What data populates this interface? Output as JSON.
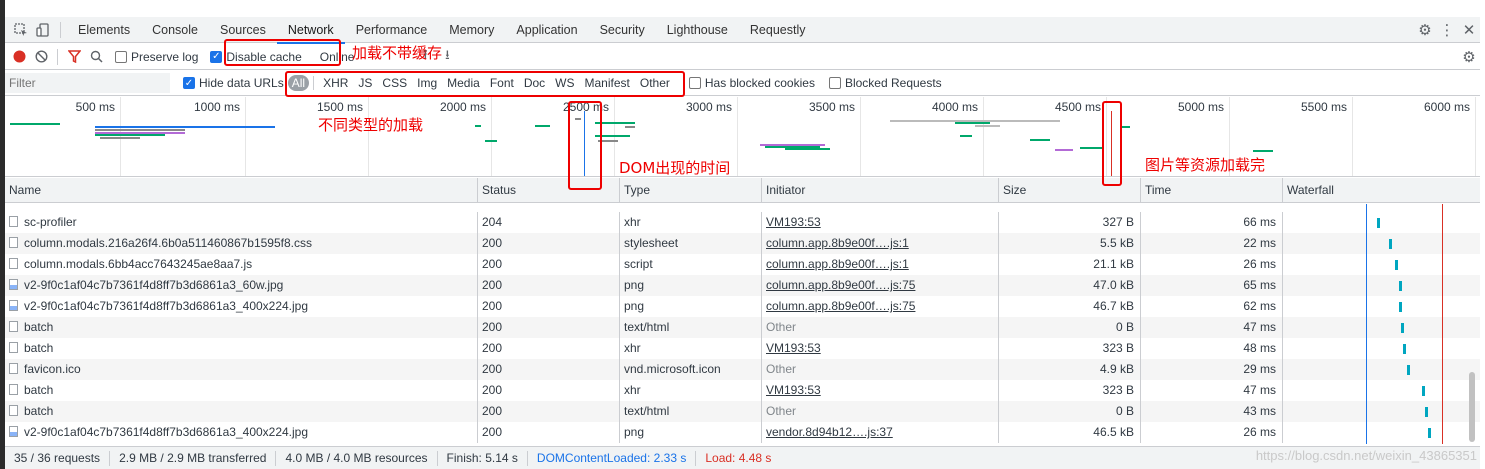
{
  "tabs": [
    "Elements",
    "Console",
    "Sources",
    "Network",
    "Performance",
    "Memory",
    "Application",
    "Security",
    "Lighthouse",
    "Requestly"
  ],
  "toolbar": {
    "preserve_log": "Preserve log",
    "disable_cache": "Disable cache",
    "throttling": "Online"
  },
  "filter": {
    "placeholder": "Filter",
    "hide_data_urls": "Hide data URLs",
    "types": [
      "All",
      "XHR",
      "JS",
      "CSS",
      "Img",
      "Media",
      "Font",
      "Doc",
      "WS",
      "Manifest",
      "Other"
    ],
    "has_blocked_cookies": "Has blocked cookies",
    "blocked_requests": "Blocked Requests"
  },
  "overview": {
    "ticks": [
      "500 ms",
      "1000 ms",
      "1500 ms",
      "2000 ms",
      "2500 ms",
      "3000 ms",
      "3500 ms",
      "4000 ms",
      "4500 ms",
      "5000 ms",
      "5500 ms",
      "6000 ms"
    ]
  },
  "annotations": {
    "disable_cache": "加载不带缓存",
    "types": "不同类型的加载",
    "dom": "DOM出现的时间",
    "load": "图片等资源加载完"
  },
  "columns": [
    "Name",
    "Status",
    "Type",
    "Initiator",
    "Size",
    "Time",
    "Waterfall"
  ],
  "requests": [
    {
      "name": "sc-profiler",
      "status": "204",
      "type": "xhr",
      "initiator": "VM193:53",
      "initiator_link": true,
      "size": "327 B",
      "time": "66 ms",
      "icon": "file",
      "wf": 0.16
    },
    {
      "name": "column.modals.216a26f4.6b0a511460867b1595f8.css",
      "status": "200",
      "type": "stylesheet",
      "initiator": "column.app.8b9e00f….js:1",
      "initiator_link": true,
      "size": "5.5 kB",
      "time": "22 ms",
      "icon": "file",
      "wf": 0.18
    },
    {
      "name": "column.modals.6bb4acc7643245ae8aa7.js",
      "status": "200",
      "type": "script",
      "initiator": "column.app.8b9e00f….js:1",
      "initiator_link": true,
      "size": "21.1 kB",
      "time": "26 ms",
      "icon": "file",
      "wf": 0.19
    },
    {
      "name": "v2-9f0c1af04c7b7361f4d8ff7b3d6861a3_60w.jpg",
      "status": "200",
      "type": "png",
      "initiator": "column.app.8b9e00f….js:75",
      "initiator_link": true,
      "size": "47.0 kB",
      "time": "65 ms",
      "icon": "img",
      "wf": 0.197
    },
    {
      "name": "v2-9f0c1af04c7b7361f4d8ff7b3d6861a3_400x224.jpg",
      "status": "200",
      "type": "png",
      "initiator": "column.app.8b9e00f….js:75",
      "initiator_link": true,
      "size": "46.7 kB",
      "time": "62 ms",
      "icon": "img",
      "wf": 0.197
    },
    {
      "name": "batch",
      "status": "200",
      "type": "text/html",
      "initiator": "Other",
      "initiator_link": false,
      "size": "0 B",
      "time": "47 ms",
      "icon": "file",
      "wf": 0.2
    },
    {
      "name": "batch",
      "status": "200",
      "type": "xhr",
      "initiator": "VM193:53",
      "initiator_link": true,
      "size": "323 B",
      "time": "48 ms",
      "icon": "file",
      "wf": 0.203
    },
    {
      "name": "favicon.ico",
      "status": "200",
      "type": "vnd.microsoft.icon",
      "initiator": "Other",
      "initiator_link": false,
      "size": "4.9 kB",
      "time": "29 ms",
      "icon": "file",
      "wf": 0.21
    },
    {
      "name": "batch",
      "status": "200",
      "type": "xhr",
      "initiator": "VM193:53",
      "initiator_link": true,
      "size": "323 B",
      "time": "47 ms",
      "icon": "file",
      "wf": 0.235
    },
    {
      "name": "batch",
      "status": "200",
      "type": "text/html",
      "initiator": "Other",
      "initiator_link": false,
      "size": "0 B",
      "time": "43 ms",
      "icon": "file",
      "wf": 0.24
    },
    {
      "name": "v2-9f0c1af04c7b7361f4d8ff7b3d6861a3_400x224.jpg",
      "status": "200",
      "type": "png",
      "initiator": "vendor.8d94b12….js:37",
      "initiator_link": true,
      "size": "46.5 kB",
      "time": "26 ms",
      "icon": "img",
      "wf": 0.245
    }
  ],
  "statusbar": {
    "requests": "35 / 36 requests",
    "transferred": "2.9 MB / 2.9 MB transferred",
    "resources": "4.0 MB / 4.0 MB resources",
    "finish": "Finish: 5.14 s",
    "dcl": "DOMContentLoaded: 2.33 s",
    "load": "Load: 4.48 s"
  },
  "colors": {
    "dcl": "#1a73e8",
    "load": "#d93025",
    "annotation": "#e00000"
  },
  "watermark": "https://blog.csdn.net/weixin_43865351"
}
